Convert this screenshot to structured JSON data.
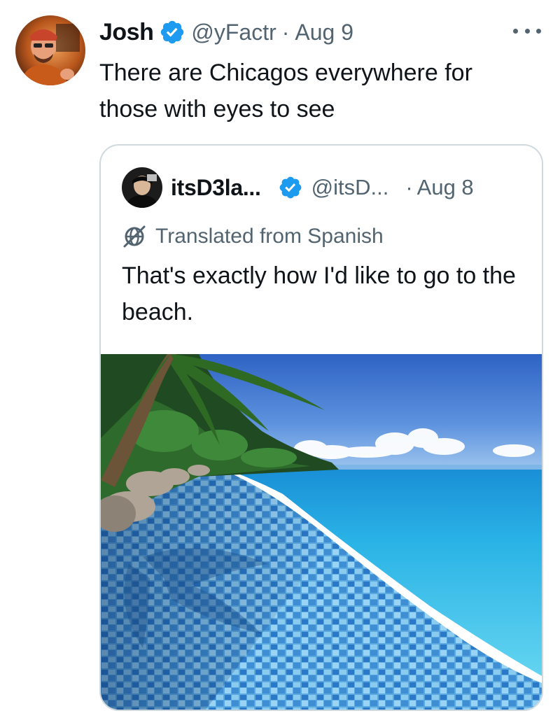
{
  "tweet": {
    "author_name": "Josh",
    "handle": "@yFactr",
    "separator": "·",
    "date": "Aug 9",
    "text": "There are Chicagos everywhere for those with eyes to see",
    "avatar_icon": "avatar-icon",
    "verified_icon": "verified-badge-icon",
    "more_icon": "more-options-icon"
  },
  "quoted_tweet": {
    "author_name": "itsD3la...",
    "handle": "@itsD...",
    "separator": "·",
    "date": "Aug 8",
    "translated_label": "Translated from Spanish",
    "text": "That's exactly how I'd like to go to the beach.",
    "avatar_icon": "avatar-icon",
    "verified_icon": "verified-badge-icon",
    "translate_icon": "translate-icon",
    "media": "beach-photo"
  },
  "colors": {
    "primary_text": "#0f1419",
    "secondary_text": "#536471",
    "verified_blue": "#1d9bf0",
    "border": "#cfd9de"
  }
}
